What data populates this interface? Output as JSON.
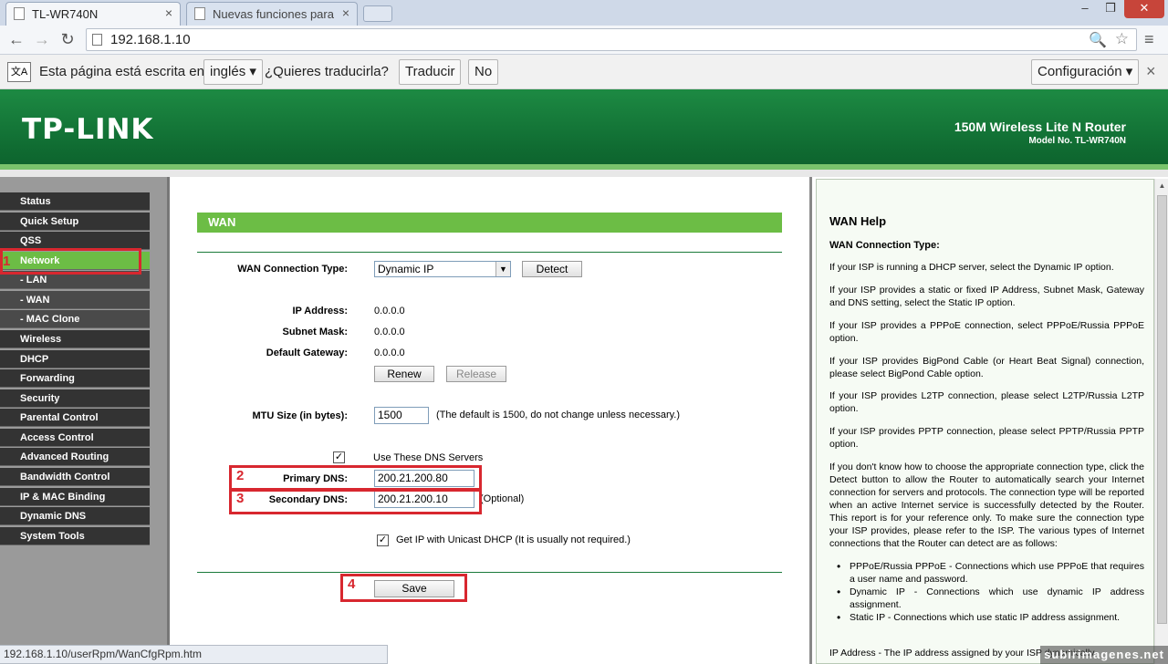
{
  "browser": {
    "tabs": [
      {
        "title": "TL-WR740N",
        "close": "×"
      },
      {
        "title": "Nuevas funciones para ca",
        "close": "×"
      }
    ],
    "window": {
      "min": "–",
      "max": "❒",
      "close": "✕"
    },
    "url": "192.168.1.10",
    "icons": {
      "back": "←",
      "forward": "→",
      "reload": "↻",
      "zoom": "🔍",
      "star": "☆",
      "menu": "≡"
    }
  },
  "translate_bar": {
    "icon_text": "文A",
    "message": "Esta página está escrita en",
    "language": "inglés ▾",
    "question": "¿Quieres traducirla?",
    "translate_btn": "Traducir",
    "no_btn": "No",
    "settings_btn": "Configuración ▾",
    "close": "×"
  },
  "header": {
    "logo": "TP-LINK",
    "product": "150M Wireless Lite N Router",
    "model": "Model No. TL-WR740N"
  },
  "menu": [
    {
      "label": "Status"
    },
    {
      "label": "Quick Setup"
    },
    {
      "label": "QSS"
    },
    {
      "label": "Network"
    },
    {
      "label": "- LAN"
    },
    {
      "label": "- WAN"
    },
    {
      "label": "- MAC Clone"
    },
    {
      "label": "Wireless"
    },
    {
      "label": "DHCP"
    },
    {
      "label": "Forwarding"
    },
    {
      "label": "Security"
    },
    {
      "label": "Parental Control"
    },
    {
      "label": "Access Control"
    },
    {
      "label": "Advanced Routing"
    },
    {
      "label": "Bandwidth Control"
    },
    {
      "label": "IP & MAC Binding"
    },
    {
      "label": "Dynamic DNS"
    },
    {
      "label": "System Tools"
    }
  ],
  "wan": {
    "title": "WAN",
    "conn_type_label": "WAN Connection Type:",
    "conn_type_value": "Dynamic IP",
    "detect_btn": "Detect",
    "ip_label": "IP Address:",
    "ip_value": "0.0.0.0",
    "mask_label": "Subnet Mask:",
    "mask_value": "0.0.0.0",
    "gw_label": "Default Gateway:",
    "gw_value": "0.0.0.0",
    "renew_btn": "Renew",
    "release_btn": "Release",
    "mtu_label": "MTU Size (in bytes):",
    "mtu_value": "1500",
    "mtu_note": "(The default is 1500, do not change unless necessary.)",
    "use_dns_label": "Use These DNS Servers",
    "primary_dns_label": "Primary DNS:",
    "primary_dns_value": "200.21.200.80",
    "secondary_dns_label": "Secondary DNS:",
    "secondary_dns_value": "200.21.200.10",
    "optional": "(Optional)",
    "unicast_label": "Get IP with Unicast DHCP (It is usually not required.)",
    "save_btn": "Save",
    "check_mark": "✓"
  },
  "annotations": [
    "1",
    "2",
    "3",
    "4"
  ],
  "help": {
    "title": "WAN Help",
    "subtitle": "WAN Connection Type:",
    "p1": "If your ISP is running a DHCP server, select the Dynamic IP option.",
    "p2": "If your ISP provides a static or fixed IP Address, Subnet Mask, Gateway and DNS setting, select the Static IP option.",
    "p3": "If your ISP provides a PPPoE connection, select PPPoE/Russia PPPoE option.",
    "p4": "If your ISP provides BigPond Cable (or Heart Beat Signal) connection, please select BigPond Cable option.",
    "p5": "If your ISP provides L2TP connection, please select L2TP/Russia L2TP option.",
    "p6": "If your ISP provides PPTP connection, please select PPTP/Russia PPTP option.",
    "p7": "If you don't know how to choose the appropriate connection type, click the Detect button to allow the Router to automatically search your Internet connection for servers and protocols. The connection type will be reported when an active Internet service is successfully detected by the Router. This report is for your reference only. To make sure the connection type your ISP provides, please refer to the ISP. The various types of Internet connections that the Router can detect are as follows:",
    "li1": "PPPoE/Russia PPPoE - Connections which use PPPoE that requires a user name and password.",
    "li2": "Dynamic IP - Connections which use dynamic IP address assignment.",
    "li3": "Static IP - Connections which use static IP address assignment.",
    "p8": "IP Address - The IP address assigned by your ISP dynamically.",
    "scroll_up": "▲"
  },
  "status_url": "192.168.1.10/userRpm/WanCfgRpm.htm",
  "watermark": "subirimagenes.net"
}
